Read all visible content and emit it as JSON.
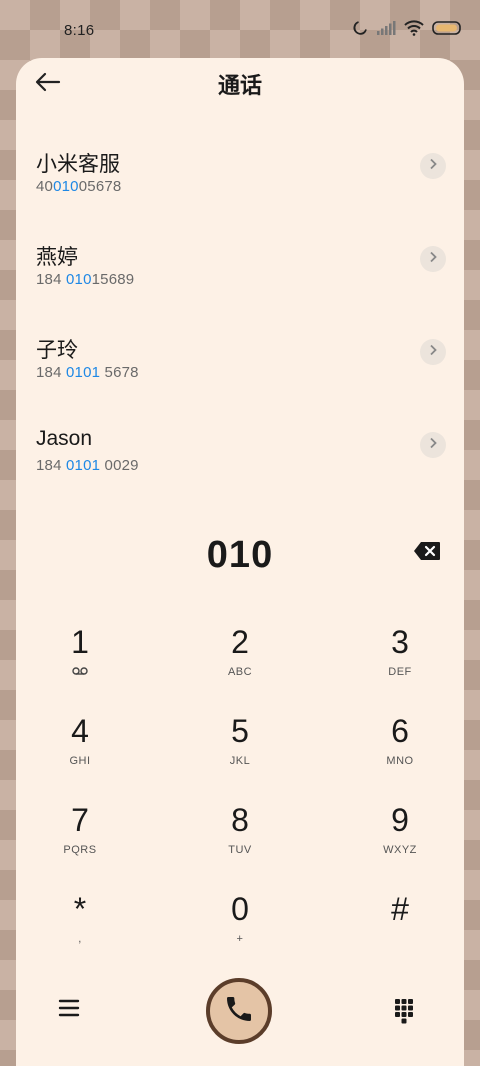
{
  "status": {
    "time": "8:16"
  },
  "header": {
    "title": "通话"
  },
  "contacts": [
    {
      "name": "小米客服",
      "num_pre": "40",
      "num_hl": "010",
      "num_post": "05678"
    },
    {
      "name": "燕婷",
      "num_pre": "184 ",
      "num_hl": "010",
      "num_post": "15689"
    },
    {
      "name": "子玲",
      "num_pre": "184 ",
      "num_hl": "0101",
      "num_post": " 5678"
    },
    {
      "name": "Jason",
      "num_pre": "184 ",
      "num_hl": "0101",
      "num_post": " 0029"
    }
  ],
  "dialer": {
    "input": "010"
  },
  "keys": [
    {
      "digit": "1",
      "letters": ""
    },
    {
      "digit": "2",
      "letters": "ABC"
    },
    {
      "digit": "3",
      "letters": "DEF"
    },
    {
      "digit": "4",
      "letters": "GHI"
    },
    {
      "digit": "5",
      "letters": "JKL"
    },
    {
      "digit": "6",
      "letters": "MNO"
    },
    {
      "digit": "7",
      "letters": "PQRS"
    },
    {
      "digit": "8",
      "letters": "TUV"
    },
    {
      "digit": "9",
      "letters": "WXYZ"
    },
    {
      "digit": "*",
      "letters": ","
    },
    {
      "digit": "0",
      "letters": "+"
    },
    {
      "digit": "#",
      "letters": ""
    }
  ],
  "icons": {
    "back": "arrow-left-icon",
    "voicemail": "voicemail-icon",
    "backspace": "backspace-icon",
    "menu": "menu-icon",
    "call": "phone-icon",
    "keypad": "keypad-icon"
  },
  "colors": {
    "highlight": "#1e88e5",
    "panel": "#fdf1e6",
    "call_button": "#e4c4a6",
    "call_border": "#5b3d2a"
  }
}
